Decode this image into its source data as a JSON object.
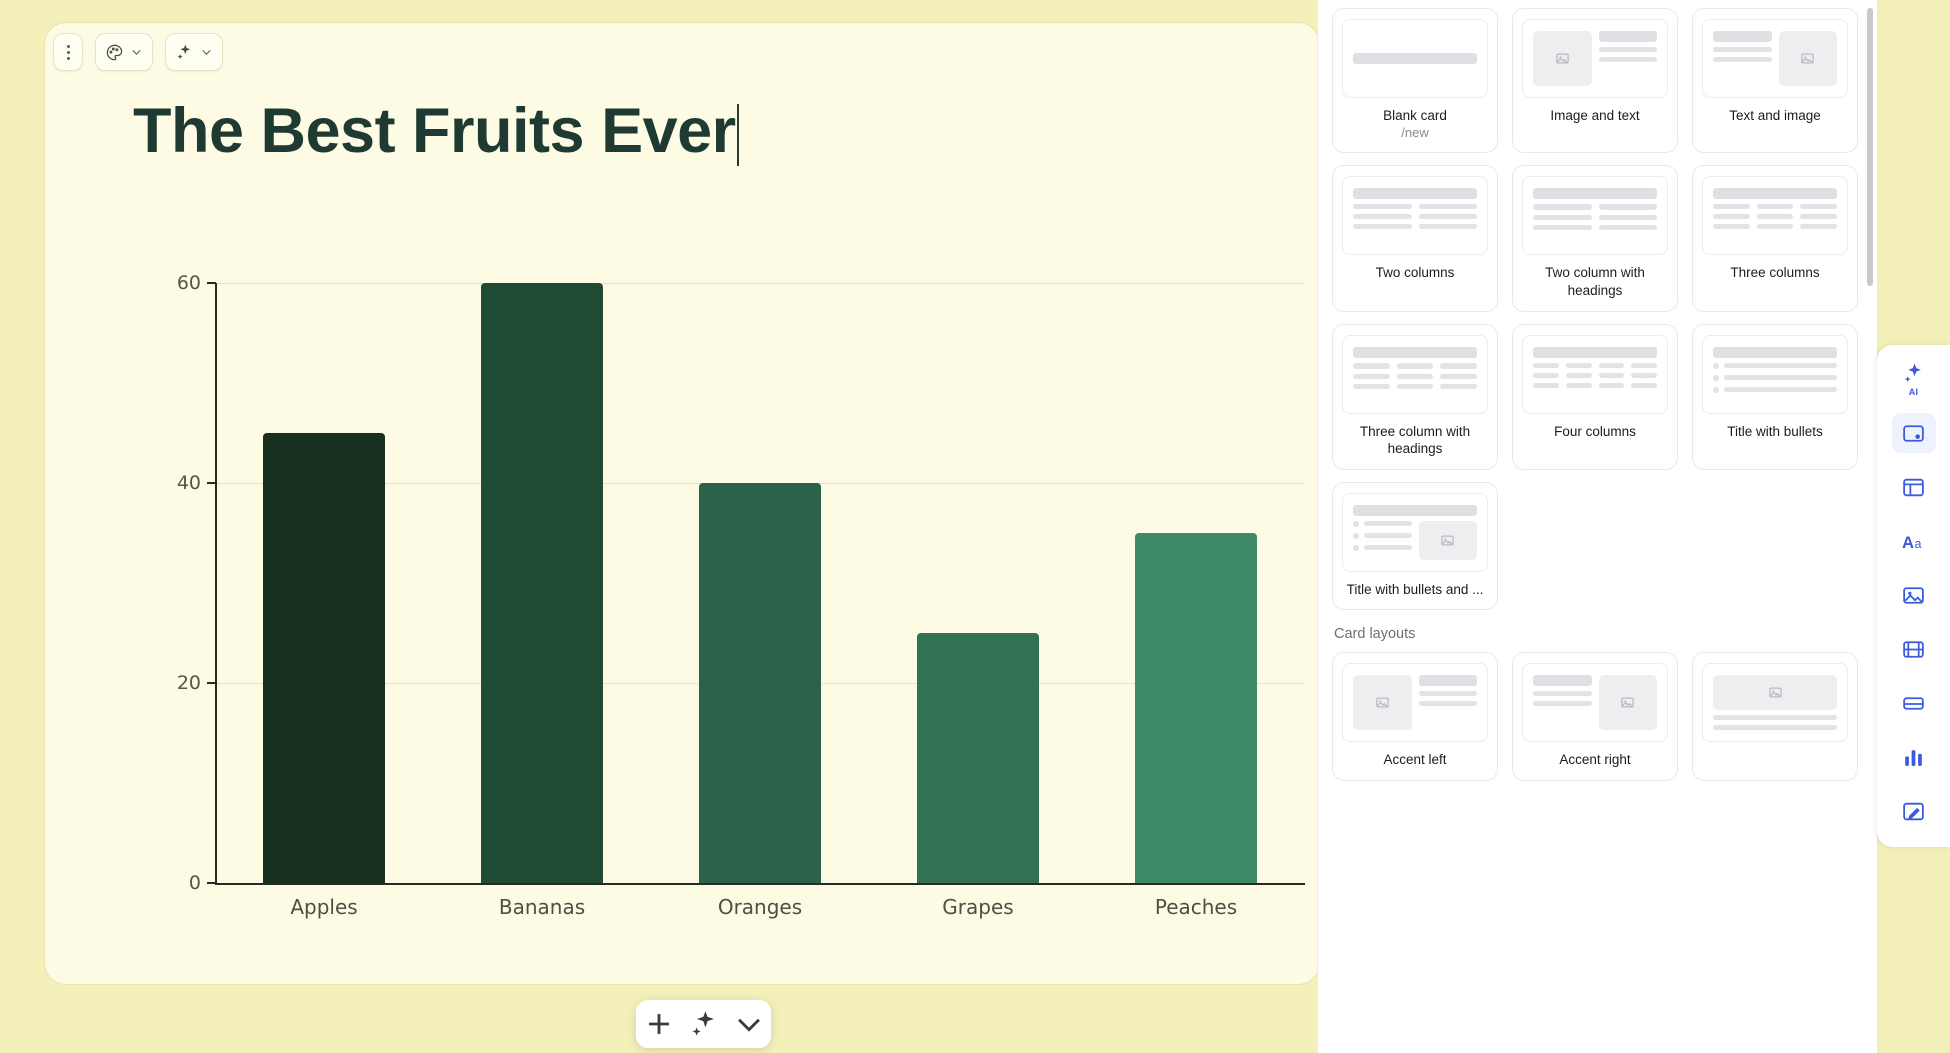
{
  "canvas": {
    "background_color": "#f4f0b9",
    "slide_background_color": "#fdfbe4",
    "title": "The Best Fruits Ever",
    "toolbar": {
      "drag_handle_label": "",
      "theme_button_label": "",
      "ai_button_label": ""
    }
  },
  "chart_data": {
    "type": "bar",
    "title": "The Best Fruits Ever",
    "xlabel": "",
    "ylabel": "",
    "categories": [
      "Apples",
      "Bananas",
      "Oranges",
      "Grapes",
      "Peaches"
    ],
    "values": [
      45,
      60,
      40,
      25,
      35
    ],
    "colors": [
      "#17301f",
      "#1f4b35",
      "#2c6249",
      "#337155",
      "#3e8a68"
    ],
    "ylim": [
      0,
      60
    ],
    "yticks": [
      0,
      20,
      40,
      60
    ],
    "ytick_labels": [
      "0",
      "20",
      "40",
      "60"
    ],
    "grid": true,
    "legend": "none"
  },
  "bottom_bar": {
    "add_label": "+",
    "ai_label": "sparkle",
    "more_label": "chevron-down"
  },
  "right_panel": {
    "sections": [
      {
        "heading": "",
        "cards": [
          {
            "name": "Blank card",
            "sub": "/new",
            "thumb": "blank"
          },
          {
            "name": "Image and text",
            "sub": "",
            "thumb": "image-left-text-right"
          },
          {
            "name": "Text and image",
            "sub": "",
            "thumb": "text-left-image-right"
          },
          {
            "name": "Two columns",
            "sub": "",
            "thumb": "two-columns"
          },
          {
            "name": "Two column with headings",
            "sub": "",
            "thumb": "two-columns-headings"
          },
          {
            "name": "Three columns",
            "sub": "",
            "thumb": "three-columns"
          },
          {
            "name": "Three column with headings",
            "sub": "",
            "thumb": "three-columns-headings"
          },
          {
            "name": "Four columns",
            "sub": "",
            "thumb": "four-columns"
          },
          {
            "name": "Title with bullets",
            "sub": "",
            "thumb": "title-bullets"
          },
          {
            "name": "Title with bullets and ...",
            "sub": "",
            "thumb": "title-bullets-image"
          }
        ]
      },
      {
        "heading": "Card layouts",
        "cards": [
          {
            "name": "Accent left",
            "sub": "",
            "thumb": "accent-left"
          },
          {
            "name": "Accent right",
            "sub": "",
            "thumb": "accent-right"
          },
          {
            "name": "",
            "sub": "",
            "thumb": "accent-top"
          }
        ]
      }
    ]
  },
  "icon_rail": {
    "items": [
      {
        "name": "ai-tools",
        "tag": "AI"
      },
      {
        "name": "cards",
        "tag": ""
      },
      {
        "name": "layouts",
        "tag": ""
      },
      {
        "name": "text",
        "tag": ""
      },
      {
        "name": "images",
        "tag": ""
      },
      {
        "name": "media",
        "tag": ""
      },
      {
        "name": "embeds",
        "tag": ""
      },
      {
        "name": "charts",
        "tag": ""
      },
      {
        "name": "drawing",
        "tag": ""
      }
    ]
  }
}
